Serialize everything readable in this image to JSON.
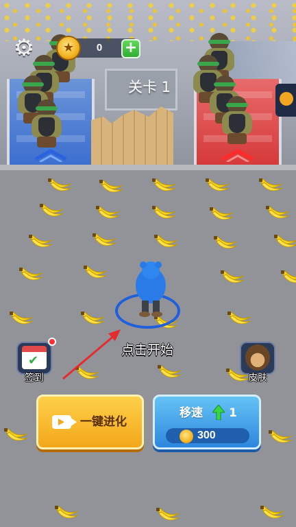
{
  "hud": {
    "coins": "0",
    "plus_label": "+",
    "level_title": "关卡 1"
  },
  "play": {
    "tap_to_start": "点击开始"
  },
  "side_buttons": {
    "checkin_label": "签到",
    "skin_label": "皮肤"
  },
  "bottom_buttons": {
    "evolve_label": "一键进化",
    "speed_label": "移速",
    "speed_level": "1",
    "speed_cost": "300"
  },
  "colors": {
    "team_blue": "#3c6fcf",
    "team_red": "#d63a3a",
    "evolve_button": "#f3a71a",
    "speed_button": "#2f86dd"
  },
  "icons": {
    "settings": "gear-icon",
    "coin": "coin-icon",
    "add": "plus-icon",
    "checkin": "calendar-check-icon",
    "skin": "monkey-avatar-icon",
    "video": "video-ad-icon",
    "upgrade": "arrow-up-icon"
  }
}
